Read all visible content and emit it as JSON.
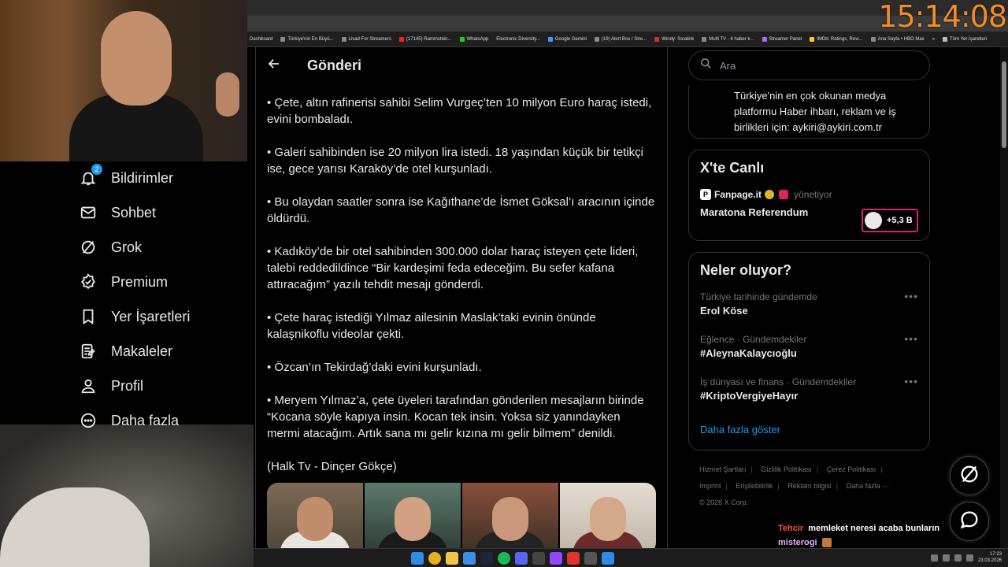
{
  "clock": "15:14:08",
  "bookmarks": [
    "Dashboard",
    "Türkiye'nin En Büyü...",
    "Livad For Streamers",
    "(17145) Rammstein...",
    "WhatsApp",
    "Electronic Diversity...",
    "Google Gemini",
    "(19) Alert Box / Stre...",
    "Windy: Sıcaklık",
    "Multi TV - 6 haber k...",
    "Streamer Panel",
    "IMDb: Ratings, Revi...",
    "Ana Sayfa • HBO Max",
    "»",
    "Tüm Yer İşaretleri"
  ],
  "sidebar": {
    "notification_count": "2",
    "items": [
      {
        "label": "Bildirimler",
        "icon": "bell-icon"
      },
      {
        "label": "Sohbet",
        "icon": "envelope-icon"
      },
      {
        "label": "Grok",
        "icon": "grok-icon"
      },
      {
        "label": "Premium",
        "icon": "verified-badge-icon"
      },
      {
        "label": "Yer İşaretleri",
        "icon": "bookmark-icon"
      },
      {
        "label": "Makaleler",
        "icon": "article-icon"
      },
      {
        "label": "Profil",
        "icon": "person-icon"
      },
      {
        "label": "Daha fazla",
        "icon": "more-circle-icon"
      }
    ]
  },
  "post": {
    "title": "Gönderi",
    "paragraphs": [
      "• Çete, altın rafinerisi sahibi Selim Vurgeç’ten 10 milyon Euro haraç istedi, evini bombaladı.",
      "• Galeri sahibinden ise 20 milyon lira istedi. 18 yaşından küçük bir tetikçi ise, gece yarısı Karaköy’de otel kurşunladı.",
      "• Bu olaydan saatler sonra ise Kağıthane’de İsmet Göksal’ı aracının içinde öldürdü.",
      "• Kadıköy’de bir otel sahibinden 300.000 dolar haraç isteyen çete lideri, talebi reddedildince “Bir kardeşimi feda edeceğim. Bu sefer kafana attıracağım” yazılı tehdit mesajı gönderdi.",
      "• Çete haraç istediği Yılmaz ailesinin Maslak’taki evinin önünde kalaşnikoflu videolar çekti.",
      "• Özcan’ın Tekirdağ’daki evini kurşunladı.",
      "• Meryem Yılmaz’a, çete üyeleri tarafından gönderilen mesajların birinde “Kocana söyle kapıya insin. Kocan tek insin. Yoksa siz yanındayken mermi atacağım. Artık sana mı gelir kızına mı gelir bilmem” denildi."
    ],
    "source": "(Halk Tv - Dinçer Gökçe)"
  },
  "search": {
    "placeholder": "Ara"
  },
  "promo": {
    "text": "Türkiye'nin en çok okunan medya platformu Haber ihbarı, reklam ve iş birlikleri için: aykiri@aykiri.com.tr"
  },
  "live": {
    "title": "X'te Canlı",
    "host": "Fanpage.it",
    "manages": "yönetiyor",
    "topic": "Maratona Referendum",
    "listeners": "+5,3 B"
  },
  "trends": {
    "title": "Neler oluyor?",
    "items": [
      {
        "meta": "Türkiye tarihinde gündemde",
        "name": "Erol Köse"
      },
      {
        "meta": "Eğlence · Gündemdekiler",
        "name": "#AleynaKalaycıoğlu"
      },
      {
        "meta": "İş dünyası ve finans · Gündemdekiler",
        "name": "#KriptoVergiyeHayır"
      }
    ],
    "show_more": "Daha fazla göster"
  },
  "footer": {
    "links": [
      "Hizmet Şartları",
      "Gizlilik Politikası",
      "Çerez Politikası",
      "Imprint",
      "Erişilebilirlik",
      "Reklam bilgisi",
      "Daha fazla ···"
    ],
    "copyright": "© 2026 X Corp."
  },
  "chat": [
    {
      "user": "Tehcir",
      "msg": "memleket neresi acaba bunların",
      "user_color": "#ff4b4b"
    },
    {
      "user": "misterogi",
      "msg": "",
      "user_color": "#e0b0ff"
    },
    {
      "user": "misterogi",
      "msg": "",
      "user_color": "#e0b0ff"
    }
  ],
  "taskbar": {
    "time": "17:23",
    "date": "23.03.2026"
  },
  "colors": {
    "accent": "#1d9bf0",
    "clock": "#f28c28",
    "live_border": "#d6206b"
  }
}
